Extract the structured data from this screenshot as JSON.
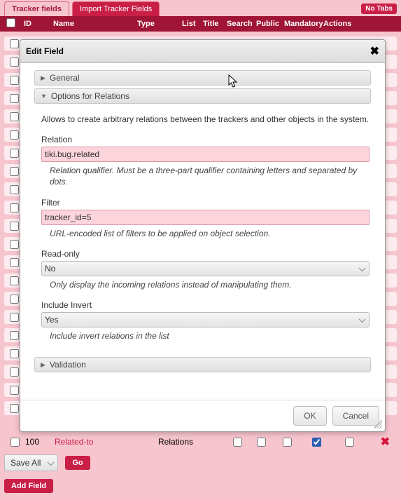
{
  "tabs": {
    "active": "Tracker fields",
    "inactive": "Import Tracker Fields",
    "no_tabs": "No Tabs"
  },
  "columns": {
    "id": "ID",
    "name": "Name",
    "type": "Type",
    "list": "List",
    "title": "Title",
    "search": "Search",
    "public": "Public",
    "mandatory": "Mandatory",
    "actions": "Actions"
  },
  "modal": {
    "title": "Edit Field",
    "sections": {
      "general": "General",
      "options": "Options for Relations",
      "validation": "Validation"
    },
    "intro": "Allows to create arbitrary relations between the trackers and other objects in the system.",
    "relation": {
      "label": "Relation",
      "value": "tiki.bug.related",
      "hint": "Relation qualifier. Must be a three-part qualifier containing letters and separated by dots."
    },
    "filter": {
      "label": "Filter",
      "value": "tracker_id=5",
      "hint": "URL-encoded list of filters to be applied on object selection."
    },
    "readonly": {
      "label": "Read-only",
      "value": "No",
      "hint": "Only display the incoming relations instead of manipulating them."
    },
    "invert": {
      "label": "Include Invert",
      "value": "Yes",
      "hint": "Include invert relations in the list"
    },
    "ok": "OK",
    "cancel": "Cancel"
  },
  "row": {
    "id": "100",
    "name": "Related-to",
    "type": "Relations"
  },
  "bottom": {
    "save_all": "Save All",
    "go": "Go",
    "add_field": "Add Field"
  }
}
